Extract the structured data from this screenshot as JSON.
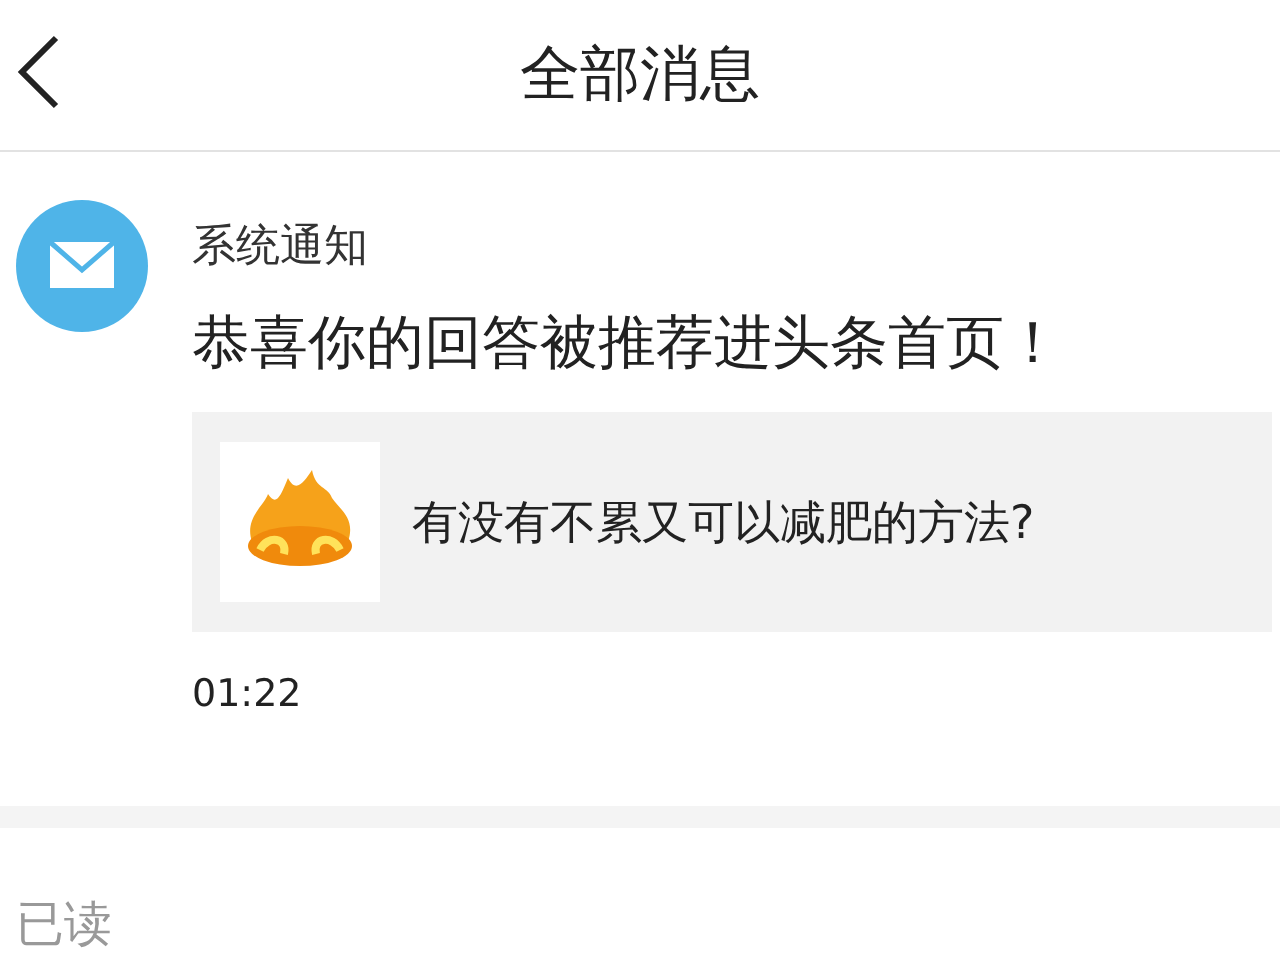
{
  "header": {
    "title": "全部消息"
  },
  "message": {
    "sender": "系统通知",
    "text": "恭喜你的回答被推荐进头条首页！",
    "question": "有没有不累又可以减肥的方法?",
    "time": "01:22"
  },
  "status": "已读"
}
